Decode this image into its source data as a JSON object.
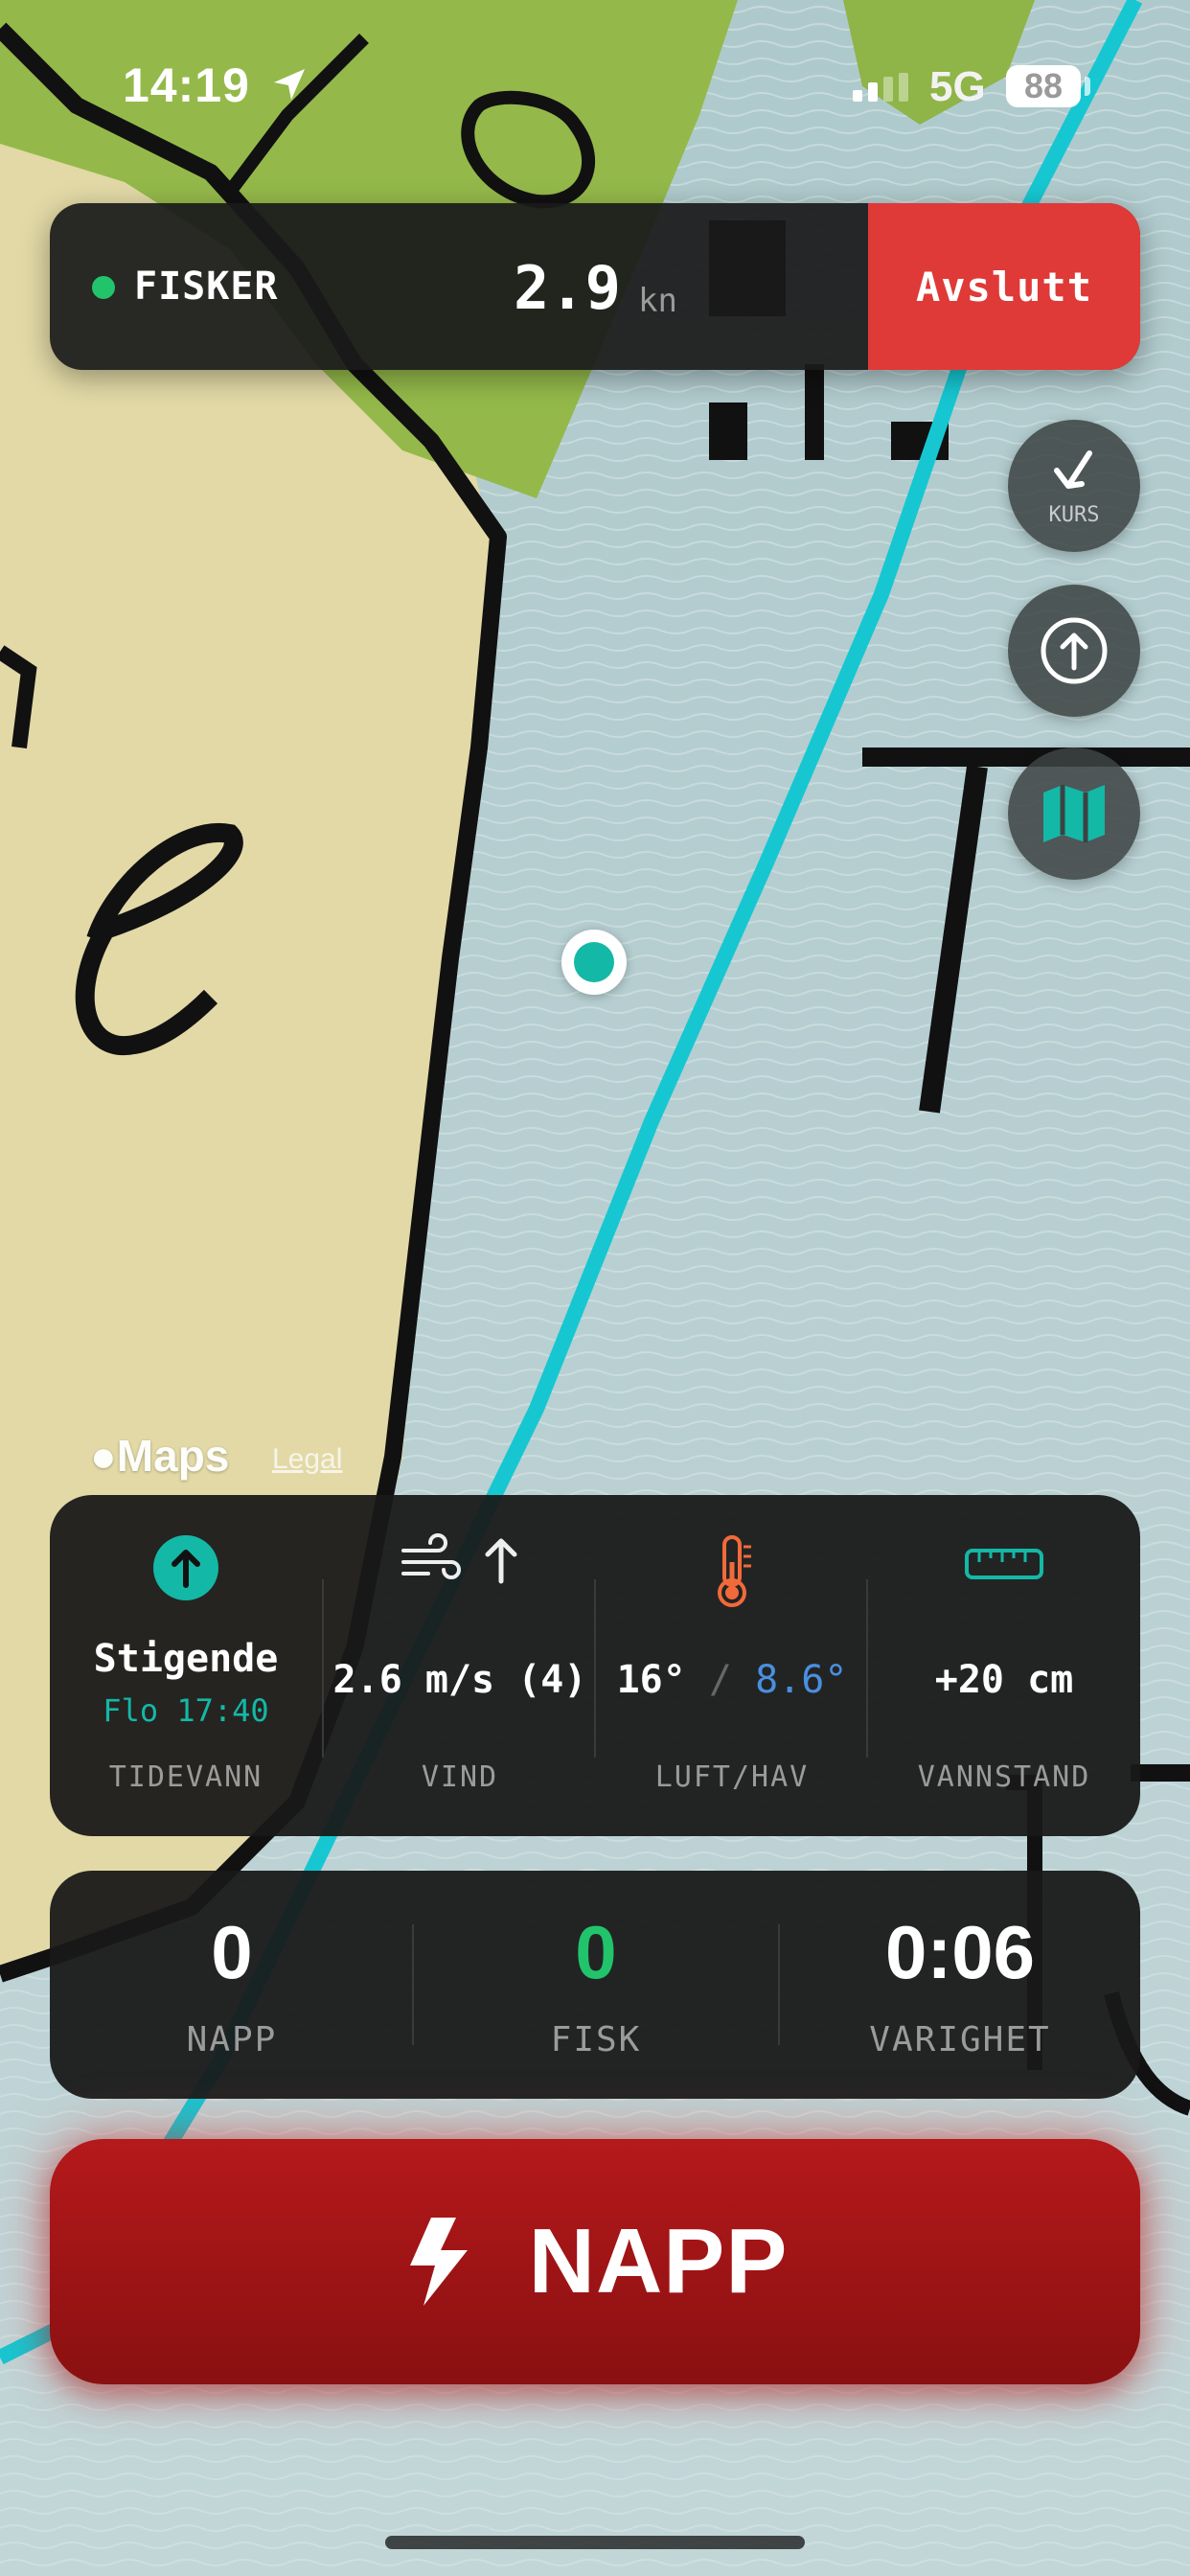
{
  "status_bar": {
    "time": "14:19",
    "network": "5G",
    "battery": "88"
  },
  "session": {
    "status_label": "FISKER",
    "speed": "2.9",
    "speed_unit": "kn",
    "end_label": "Avslutt",
    "status_color": "#22c46b",
    "end_color": "#df3a37"
  },
  "map_controls": {
    "course_label": "KURS"
  },
  "map": {
    "brand": "Maps",
    "legal": "Legal"
  },
  "conditions": {
    "tide": {
      "value": "Stigende",
      "sub": "Flo 17:40",
      "label": "TIDEVANN"
    },
    "wind": {
      "value": "2.6 m/s (4)",
      "label": "VIND"
    },
    "temp": {
      "air": "16°",
      "sep": "/",
      "sea": "8.6°",
      "label": "LUFT/HAV"
    },
    "water_level": {
      "value": "+20 cm",
      "label": "VANNSTAND"
    }
  },
  "stats": [
    {
      "value": "0",
      "label": "NAPP"
    },
    {
      "value": "0",
      "label": "FISK"
    },
    {
      "value": "0:06",
      "label": "VARIGHET"
    }
  ],
  "napp_button": {
    "label": "NAPP"
  },
  "colors": {
    "accent_teal": "#14b8a6",
    "sea_temp_blue": "#4a8fe0",
    "fish_green": "#22c46b",
    "napp_red": "#b5191b",
    "thermometer_orange": "#f26a3a"
  }
}
